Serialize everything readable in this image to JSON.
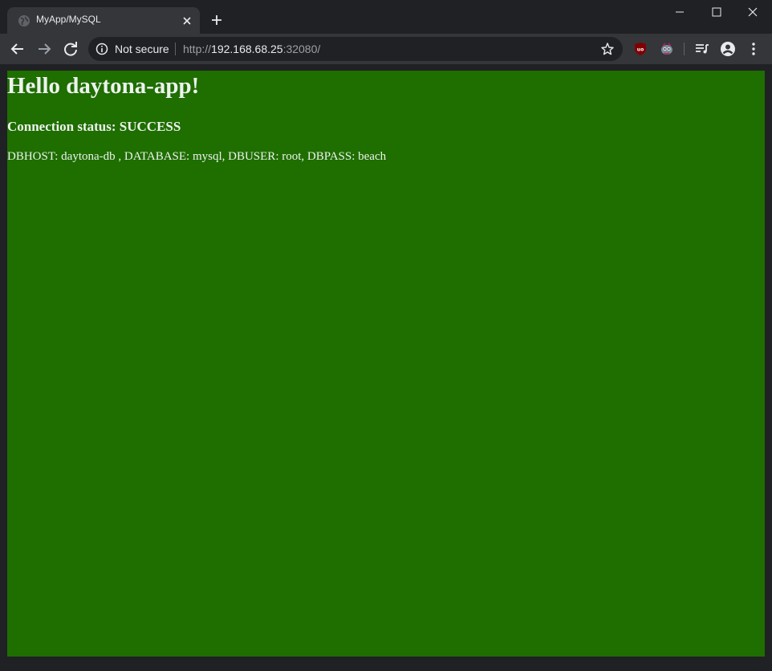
{
  "browser": {
    "tab": {
      "title": "MyApp/MySQL",
      "favicon": "globe-icon",
      "close_icon": "close-icon"
    },
    "new_tab_icon": "plus-icon",
    "window_controls": [
      "minimize-icon",
      "maximize-icon",
      "close-icon"
    ],
    "toolbar": {
      "back_icon": "arrow-left-icon",
      "forward_icon": "arrow-right-icon",
      "reload_icon": "reload-icon",
      "security_label": "Not secure",
      "url_scheme": "http://",
      "url_host": "192.168.68.25",
      "url_rest": ":32080/",
      "bookmark_icon": "star-icon",
      "extensions": [
        "ublock-origin-icon",
        "extension-mascot-icon"
      ],
      "media_icon": "media-control-icon",
      "profile_icon": "account-circle-icon",
      "menu_icon": "kebab-menu-icon"
    }
  },
  "page": {
    "background_color": "#1e6e00",
    "heading": "Hello daytona-app!",
    "status": "Connection status: SUCCESS",
    "details": "DBHOST: daytona-db , DATABASE: mysql, DBUSER: root, DBPASS: beach"
  }
}
